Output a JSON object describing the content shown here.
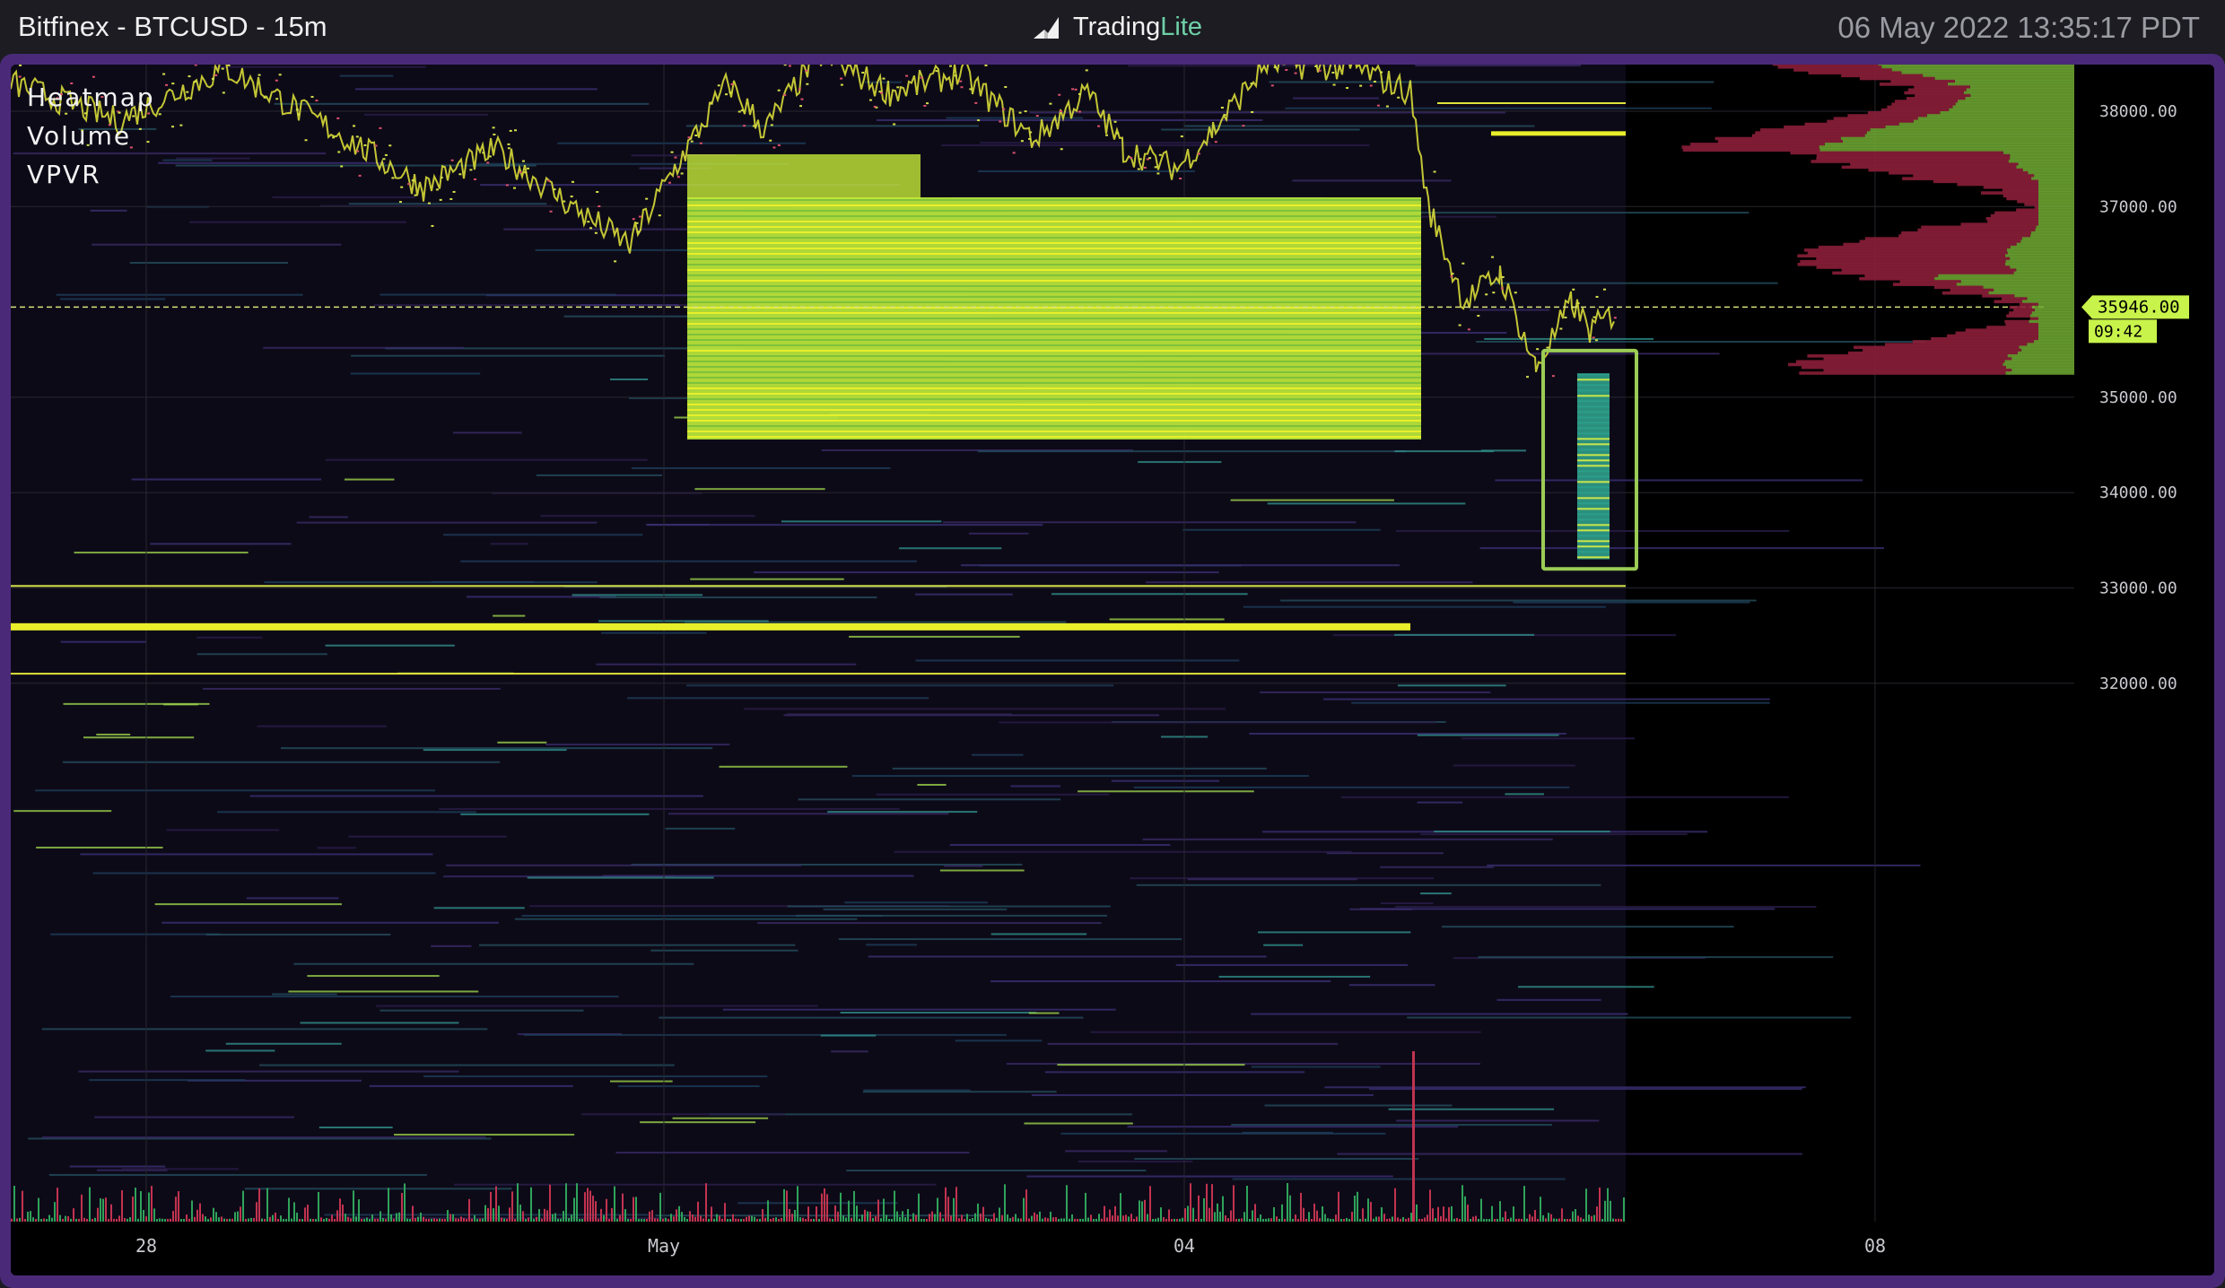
{
  "header": {
    "title": "Bitfinex - BTCUSD - 15m",
    "logo_name": "Trading",
    "logo_suffix": "Lite",
    "datetime": "06 May 2022 13:35:17 PDT"
  },
  "layers": [
    "Heatmap",
    "Volume",
    "VPVR"
  ],
  "y_axis": {
    "labels": [
      "38000.00",
      "37000.00",
      "35000.00",
      "34000.00",
      "33000.00",
      "32000.00"
    ],
    "values": [
      38000,
      37000,
      35000,
      34000,
      33000,
      32000
    ]
  },
  "x_axis": {
    "labels": [
      "28",
      "May",
      "04",
      "08"
    ]
  },
  "current_price": {
    "price": "35946.00",
    "countdown": "09:42"
  },
  "colors": {
    "frame": "#4a2a78",
    "accent_yellow": "#e8ef2a",
    "vpvr_green": "#6fa832",
    "vpvr_red": "#8a1e38",
    "price_tag": "#c8f34a",
    "selection_box": "#9ccc55"
  },
  "icons": {
    "logo": "tradinglite-logo-icon"
  }
}
